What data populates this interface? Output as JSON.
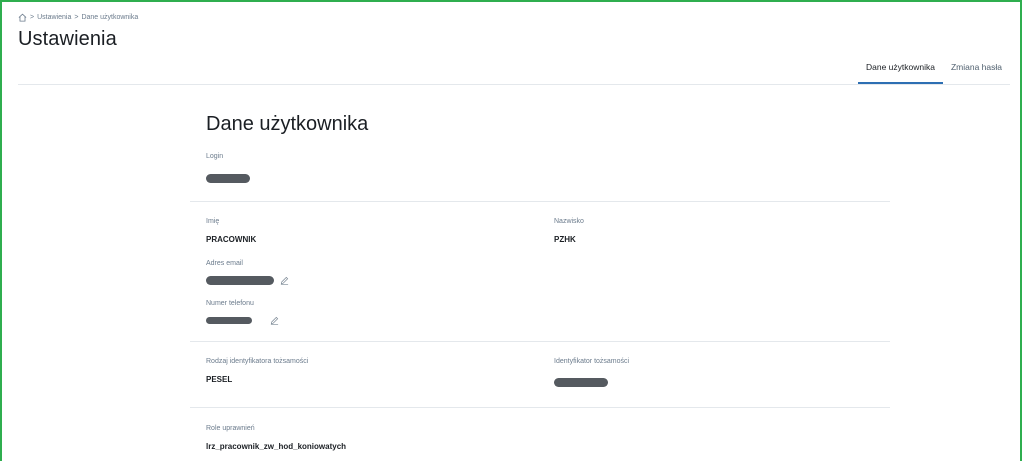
{
  "breadcrumb": {
    "items": [
      "Ustawienia",
      "Dane użytkownika"
    ],
    "separator": ">"
  },
  "page": {
    "title": "Ustawienia"
  },
  "tabs": [
    {
      "label": "Dane użytkownika",
      "active": true
    },
    {
      "label": "Zmiana hasła",
      "active": false
    }
  ],
  "section": {
    "title": "Dane użytkownika"
  },
  "fields": {
    "login": {
      "label": "Login"
    },
    "imie": {
      "label": "Imię",
      "value": "PRACOWNIK"
    },
    "nazwisko": {
      "label": "Nazwisko",
      "value": "PZHK"
    },
    "email": {
      "label": "Adres email"
    },
    "telefon": {
      "label": "Numer telefonu"
    },
    "rodzaj_id": {
      "label": "Rodzaj identyfikatora tożsamości",
      "value": "PESEL"
    },
    "identyfikator": {
      "label": "Identyfikator tożsamości"
    },
    "role": {
      "label": "Role uprawnień",
      "value": "lrz_pracownik_zw_hod_koniowatych"
    }
  },
  "colors": {
    "frame": "#2fae4f",
    "accent": "#2d6fb3",
    "redaction": "#555a60"
  },
  "icons": {
    "home": "home-icon",
    "edit": "pencil-icon"
  }
}
